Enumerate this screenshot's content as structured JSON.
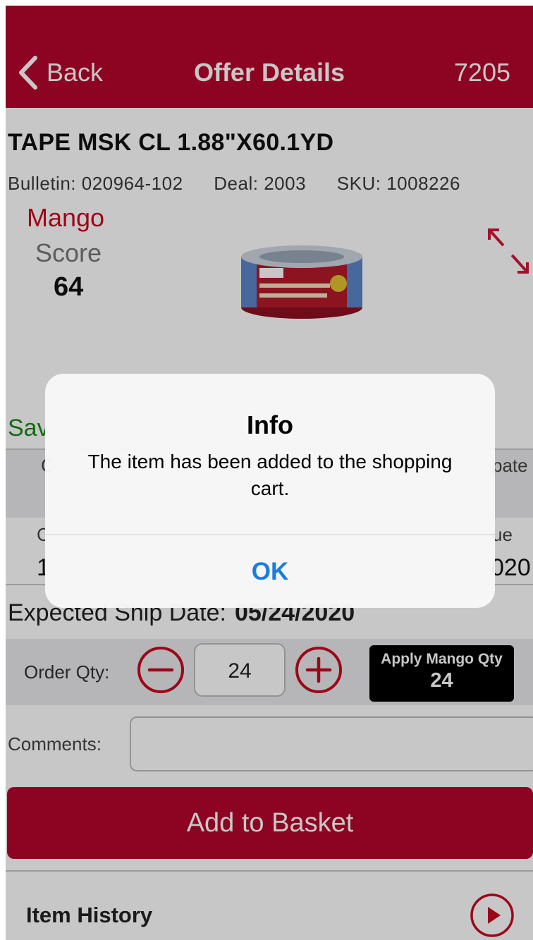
{
  "header": {
    "back_label": "Back",
    "title": "Offer Details",
    "number": "7205"
  },
  "item": {
    "title": "TAPE MSK CL 1.88\"X60.1YD",
    "bulletin_label": "Bulletin:",
    "bulletin_value": "020964-102",
    "deal_label": "Deal:",
    "deal_value": "2003",
    "sku_label": "SKU:",
    "sku_value": "1008226"
  },
  "score": {
    "mango_label": "Mango",
    "score_label": "Score",
    "value": "64"
  },
  "partial": {
    "save_label": "Sav",
    "col_head_left": "C",
    "col_head_right": "pate",
    "row2_left": "C",
    "row2_right": "ue",
    "row3_left": "1",
    "row3_right": "020"
  },
  "ship": {
    "label": "Expected Ship Date:",
    "value": "05/24/2020"
  },
  "order": {
    "qty_label": "Order Qty:",
    "qty_value": "24",
    "apply_label": "Apply Mango Qty",
    "apply_value": "24"
  },
  "comments": {
    "label": "Comments:",
    "value": ""
  },
  "actions": {
    "add_basket_label": "Add to Basket",
    "item_history_label": "Item History"
  },
  "dialog": {
    "title": "Info",
    "message": "The item has been added to the shopping cart.",
    "ok_label": "OK"
  },
  "colors": {
    "brand_red": "#b5052c",
    "mango_red": "#c8091f",
    "save_green": "#1a8a1a",
    "ios_blue": "#1a7ee0"
  },
  "icons": [
    "chevron-left-icon",
    "expand-arrows-icon",
    "minus-circle-icon",
    "plus-circle-icon",
    "play-circle-icon",
    "product-image"
  ]
}
